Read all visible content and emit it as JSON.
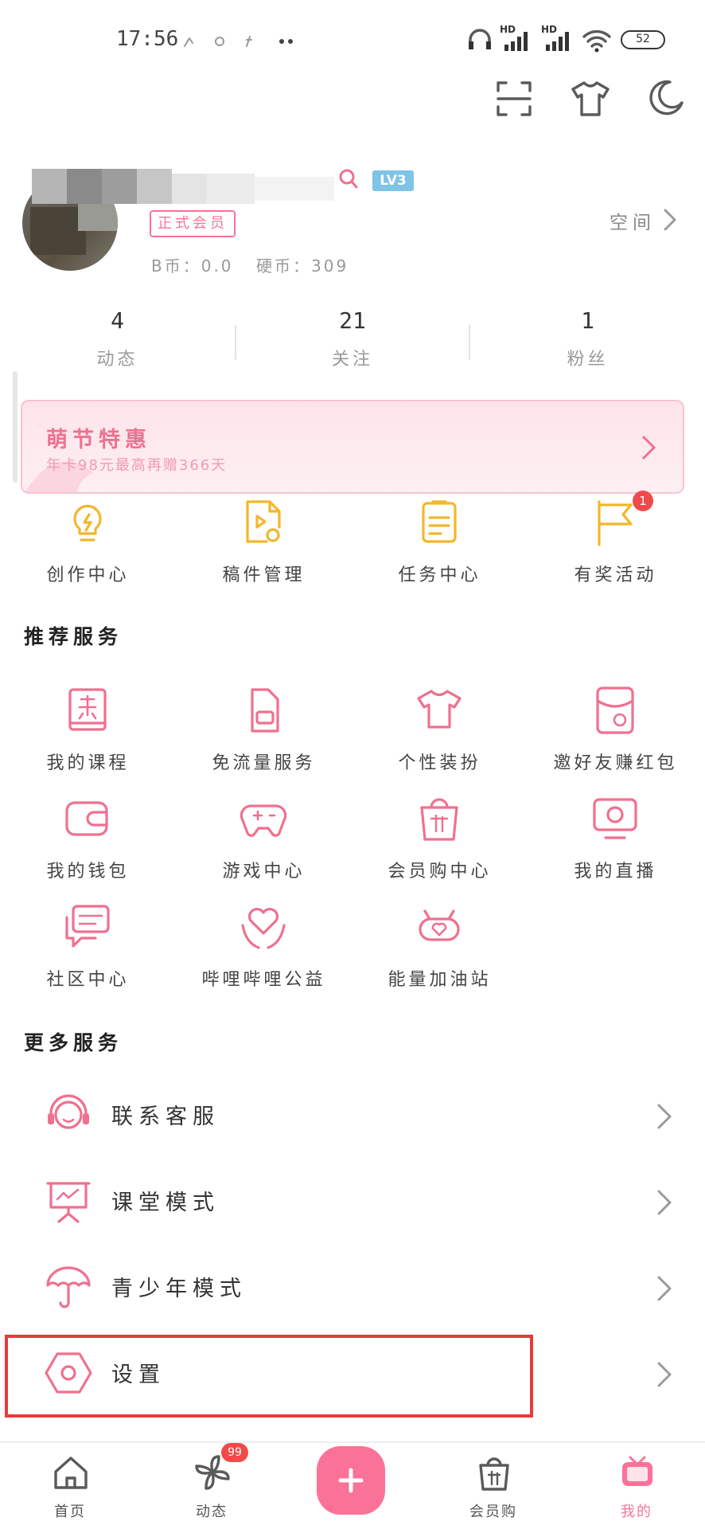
{
  "status_bar": {
    "time": "17:56",
    "signal1": "HD",
    "signal2": "HD",
    "battery": "52"
  },
  "profile": {
    "member_badge": "正式会员",
    "level": "LV3",
    "coins_b": "B币：0.0",
    "coins_hard": "硬币：309",
    "space_link": "空间"
  },
  "stats": [
    {
      "value": "4",
      "label": "动态"
    },
    {
      "value": "21",
      "label": "关注"
    },
    {
      "value": "1",
      "label": "粉丝"
    }
  ],
  "promo": {
    "title": "萌节特惠",
    "subtitle": "年卡98元最高再赠366天"
  },
  "quick_actions": [
    {
      "label": "创作中心",
      "icon": "lightbulb-icon"
    },
    {
      "label": "稿件管理",
      "icon": "video-file-icon"
    },
    {
      "label": "任务中心",
      "icon": "clipboard-icon"
    },
    {
      "label": "有奖活动",
      "icon": "flag-icon",
      "badge": "1"
    }
  ],
  "recommended": {
    "title": "推荐服务",
    "items": [
      {
        "label": "我的课程",
        "icon": "course-book-icon"
      },
      {
        "label": "免流量服务",
        "icon": "sim-card-icon"
      },
      {
        "label": "个性装扮",
        "icon": "tshirt-icon"
      },
      {
        "label": "邀好友赚红包",
        "icon": "red-envelope-icon"
      },
      {
        "label": "我的钱包",
        "icon": "wallet-icon"
      },
      {
        "label": "游戏中心",
        "icon": "gamepad-icon"
      },
      {
        "label": "会员购中心",
        "icon": "shopping-bag-icon"
      },
      {
        "label": "我的直播",
        "icon": "tv-icon"
      },
      {
        "label": "社区中心",
        "icon": "chat-bubbles-icon"
      },
      {
        "label": "哔哩哔哩公益",
        "icon": "heart-hands-icon"
      },
      {
        "label": "能量加油站",
        "icon": "energy-station-icon"
      }
    ]
  },
  "more": {
    "title": "更多服务",
    "items": [
      {
        "label": "联系客服",
        "icon": "headset-icon"
      },
      {
        "label": "课堂模式",
        "icon": "classroom-board-icon"
      },
      {
        "label": "青少年模式",
        "icon": "umbrella-icon"
      },
      {
        "label": "设置",
        "icon": "settings-hexagon-icon"
      }
    ]
  },
  "tabbar": {
    "items": [
      {
        "label": "首页",
        "icon": "home-icon"
      },
      {
        "label": "动态",
        "icon": "pinwheel-icon",
        "badge": "99"
      },
      {
        "label": "",
        "icon": "plus-icon"
      },
      {
        "label": "会员购",
        "icon": "shopping-bag-icon"
      },
      {
        "label": "我的",
        "icon": "tv-mascot-icon"
      }
    ]
  },
  "colors": {
    "accent": "#fb7299",
    "yellow": "#f2b72a",
    "highlight_box": "#e8393c",
    "badge_red": "#f04a4a"
  }
}
